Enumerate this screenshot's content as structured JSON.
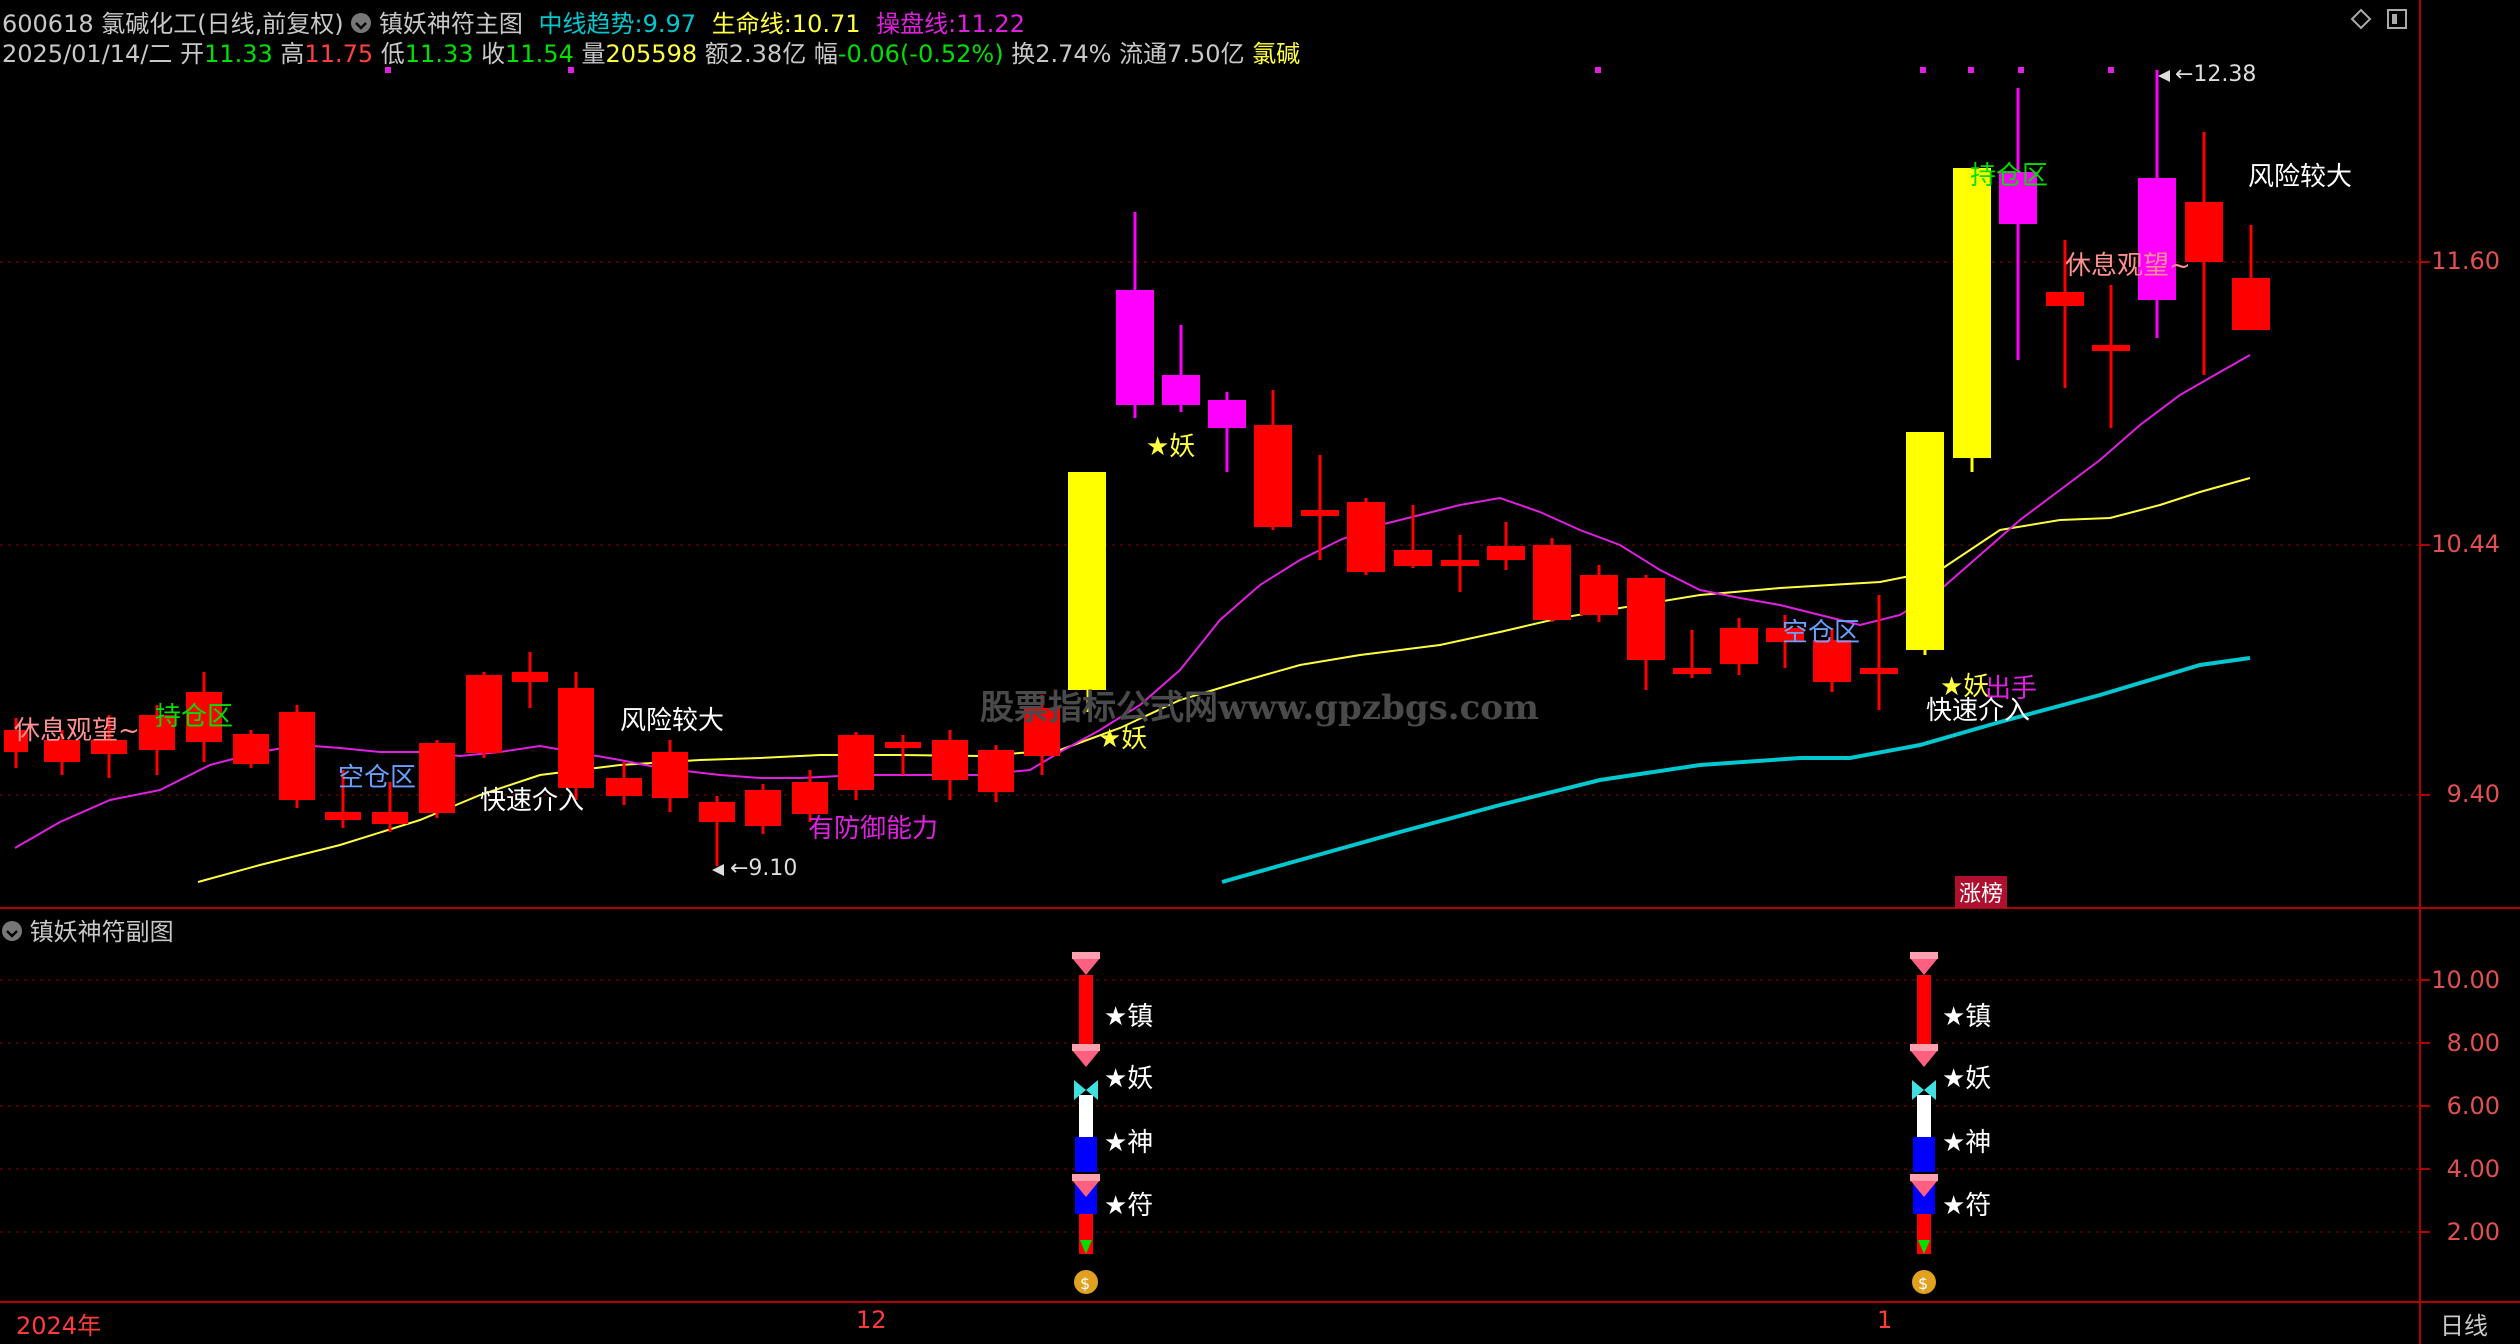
{
  "header": {
    "code": "600618",
    "name": "氯碱化工(日线,前复权)",
    "indicator_name": "镇妖神符主图",
    "mid_trend_label": "中线趋势:",
    "mid_trend_value": "9.97",
    "life_line_label": "生命线:",
    "life_line_value": "10.71",
    "trade_line_label": "操盘线:",
    "trade_line_value": "11.22"
  },
  "quote": {
    "date": "2025/01/14/二",
    "open_label": "开",
    "open": "11.33",
    "high_label": "高",
    "high": "11.75",
    "low_label": "低",
    "low": "11.33",
    "close_label": "收",
    "close": "11.54",
    "volume_label": "量",
    "volume": "205598",
    "amount_label": "额",
    "amount": "2.38亿",
    "change_label": "幅",
    "change": "-0.06(-0.52%)",
    "turnover_label": "换",
    "turnover": "2.74%",
    "float_label": "流通",
    "float": "7.50亿",
    "sector": "氯碱"
  },
  "price_axis": [
    "11.60",
    "10.44",
    "9.40"
  ],
  "sub_axis": [
    "10.00",
    "8.00",
    "6.00",
    "4.00",
    "2.00"
  ],
  "sub_panel_title": "镇妖神符副图",
  "time_axis": {
    "year": "2024年",
    "m12": "12",
    "m1": "1",
    "period": "日线"
  },
  "watermark": "股票指标公式网www.gpzbgs.com",
  "annotations": {
    "rest_watch": "休息观望~",
    "hold_zone": "持仓区",
    "empty_zone": "空仓区",
    "fast_entry": "快速介入",
    "high_risk": "风险较大",
    "defense": "有防御能力",
    "yao": "★妖",
    "low_price": "←9.10",
    "high_price": "←12.38",
    "zhangbang": "涨榜",
    "chushou": "出手"
  },
  "signal_labels": [
    "★镇",
    "★妖",
    "★神",
    "★符"
  ],
  "colors": {
    "up": "#ff0000",
    "limit_up": "#ffff00",
    "strong": "#ff00ff",
    "ma_white": "#ffff40",
    "ma_magenta": "#e020e0",
    "ma_cyan": "#00c8d0",
    "grid": "#8a0000"
  }
}
